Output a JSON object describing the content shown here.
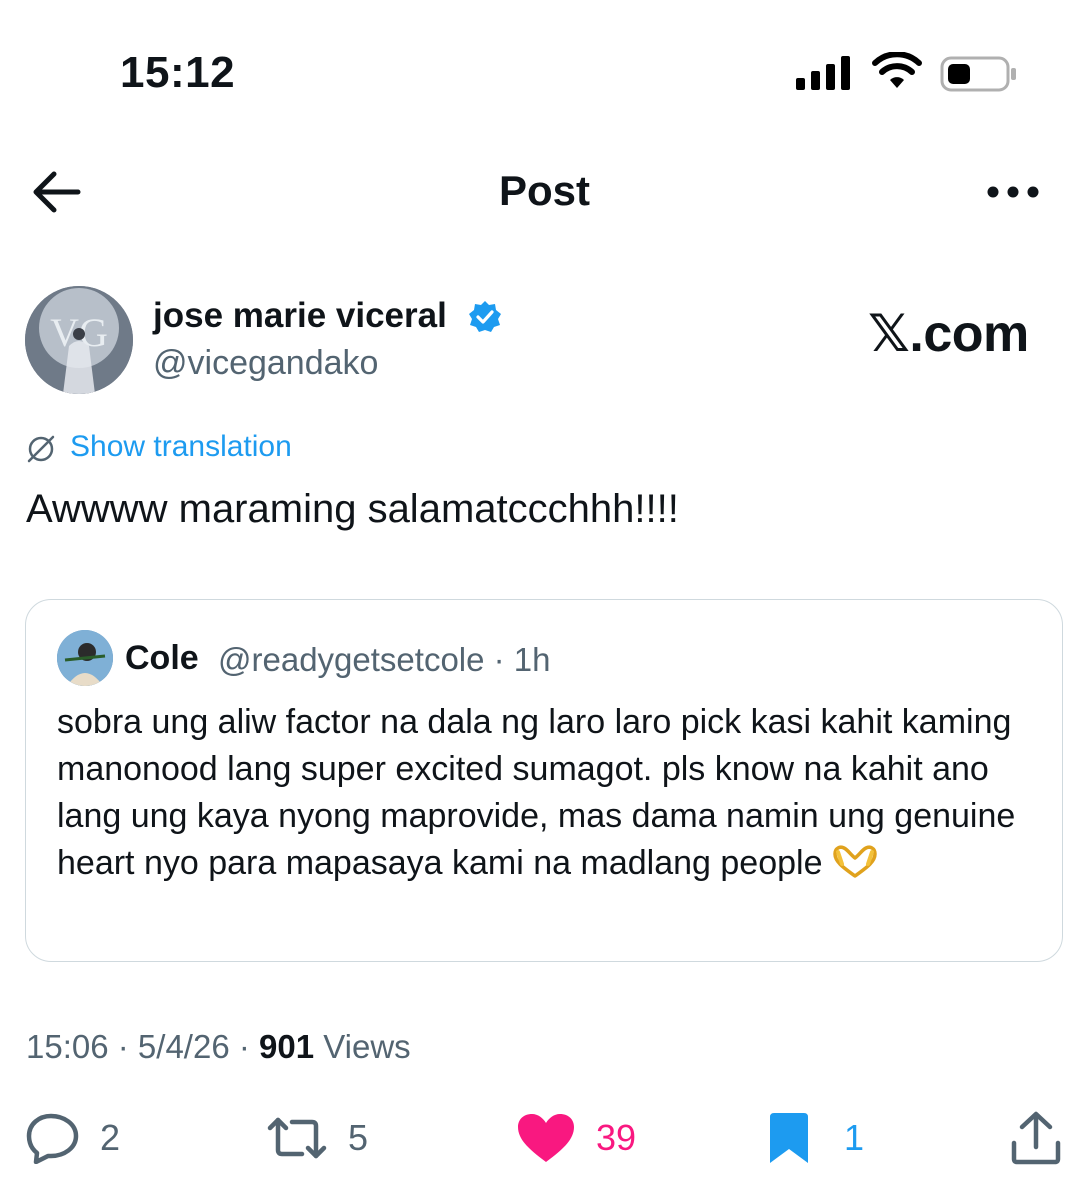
{
  "status_bar": {
    "time": "15:12"
  },
  "header": {
    "title": "Post",
    "back_icon": "arrow-left-icon",
    "more_icon": "more-horizontal-icon"
  },
  "author": {
    "name": "jose marie viceral",
    "handle": "@vicegandako",
    "verified": true
  },
  "watermark": "𝕏.com",
  "translation": {
    "label": "Show translation"
  },
  "post": {
    "text": "Awwww maraming salamatccchhh!!!!"
  },
  "quote": {
    "name": "Cole",
    "handle_time": "@readygetsetcole · 1h",
    "text": "sobra ung aliw factor na dala ng laro laro pick kasi kahit kaming manonood lang super excited sumagot. pls know na kahit ano lang ung kaya nyong maprovide, mas dama namin ung genuine heart nyo para mapasaya kami na madlang people"
  },
  "meta": {
    "time": "15:06",
    "sep1": " · ",
    "date": "5/4/26",
    "sep2": " · ",
    "views_count": "901",
    "views_label": " Views"
  },
  "actions": {
    "replies": "2",
    "reposts": "5",
    "likes": "39",
    "bookmarks": "1"
  },
  "colors": {
    "accent_blue": "#1d9bf0",
    "like_pink": "#f91880",
    "secondary_text": "#536471"
  }
}
